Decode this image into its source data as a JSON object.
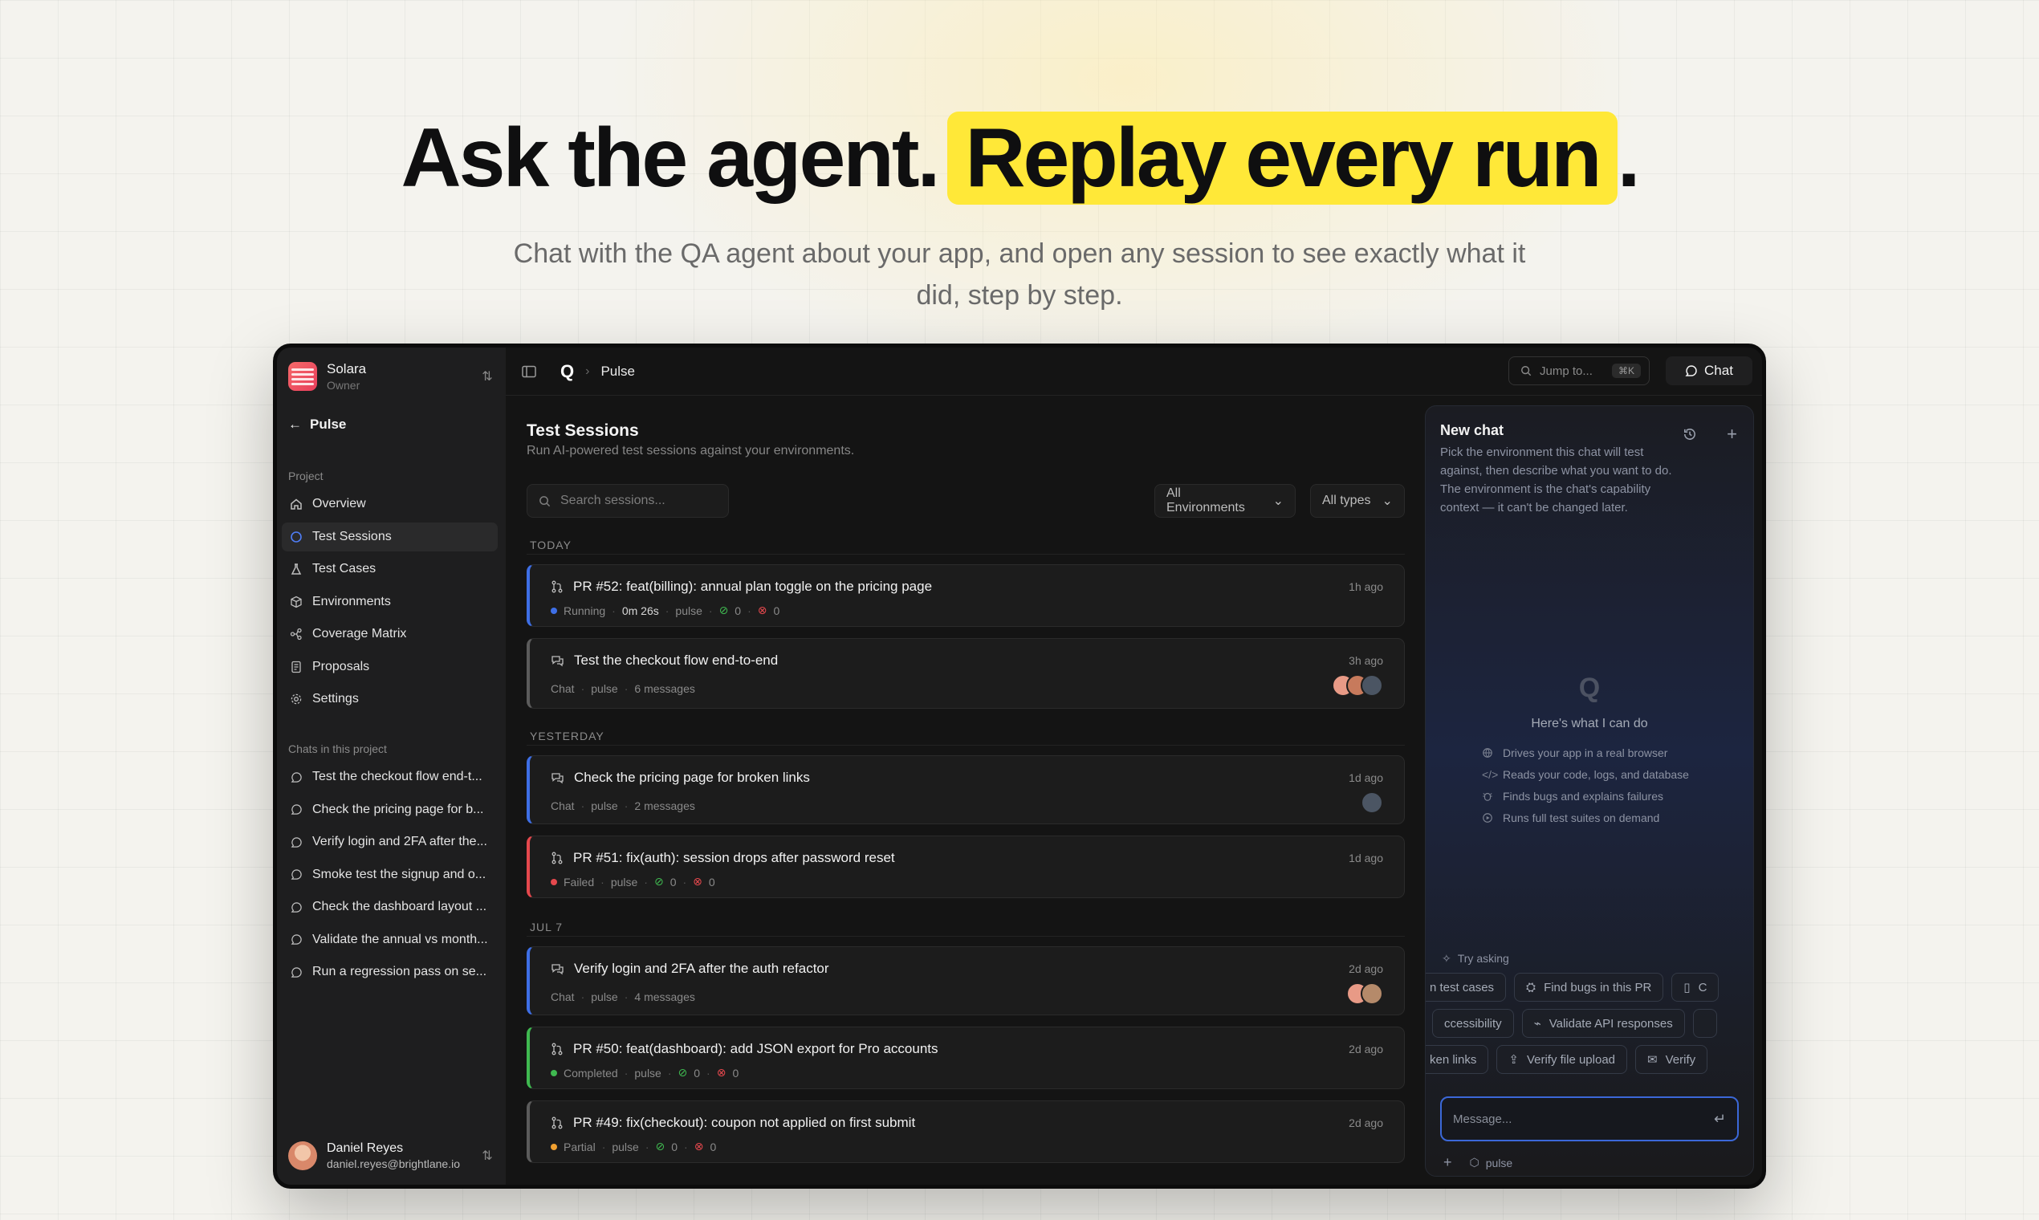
{
  "hero": {
    "title_part1": "Ask the agent.",
    "title_highlight": "Replay every run",
    "title_end": ".",
    "subtitle": "Chat with the QA agent about your app, and open any session to see exactly what it did, step by step."
  },
  "sidebar": {
    "org_name": "Solara",
    "org_role": "Owner",
    "back_label": "Pulse",
    "project_label": "Project",
    "nav": [
      {
        "label": "Overview",
        "icon": "home-icon"
      },
      {
        "label": "Test Sessions",
        "icon": "chat-bubble-icon",
        "active": true
      },
      {
        "label": "Test Cases",
        "icon": "flask-icon"
      },
      {
        "label": "Environments",
        "icon": "cube-icon"
      },
      {
        "label": "Coverage Matrix",
        "icon": "nodes-icon"
      },
      {
        "label": "Proposals",
        "icon": "document-icon"
      },
      {
        "label": "Settings",
        "icon": "gear-icon"
      }
    ],
    "chats_label": "Chats in this project",
    "chats": [
      "Test the checkout flow end-t...",
      "Check the pricing page for b...",
      "Verify login and 2FA after the...",
      "Smoke test the signup and o...",
      "Check the dashboard layout ...",
      "Validate the annual vs month...",
      "Run a regression pass on se..."
    ],
    "user_name": "Daniel Reyes",
    "user_email": "daniel.reyes@brightlane.io"
  },
  "topbar": {
    "logo": "Q",
    "breadcrumb": "Pulse",
    "jump_placeholder": "Jump to...",
    "jump_kbd": "⌘K",
    "chat_label": "Chat"
  },
  "sessions": {
    "title": "Test Sessions",
    "subtitle": "Run AI-powered test sessions against your environments.",
    "search_placeholder": "Search sessions...",
    "filter_env": "All Environments",
    "filter_type": "All types",
    "groups": [
      "TODAY",
      "YESTERDAY",
      "JUL 7"
    ],
    "items": [
      {
        "title": "PR #52: feat(billing): annual plan toggle on the pricing page",
        "time": "1h ago",
        "status": "Running",
        "duration": "0m 26s",
        "env": "pulse",
        "pass": "0",
        "fail": "0",
        "status_color": "#3e6fe6"
      },
      {
        "title": "Test the checkout flow end-to-end",
        "time": "3h ago",
        "kind": "Chat",
        "env": "pulse",
        "messages": "6 messages"
      },
      {
        "title": "Check the pricing page for broken links",
        "time": "1d ago",
        "kind": "Chat",
        "env": "pulse",
        "messages": "2 messages"
      },
      {
        "title": "PR #51: fix(auth): session drops after password reset",
        "time": "1d ago",
        "status": "Failed",
        "env": "pulse",
        "pass": "0",
        "fail": "0",
        "status_color": "#e5484d"
      },
      {
        "title": "Verify login and 2FA after the auth refactor",
        "time": "2d ago",
        "kind": "Chat",
        "env": "pulse",
        "messages": "4 messages"
      },
      {
        "title": "PR #50: feat(dashboard): add JSON export for Pro accounts",
        "time": "2d ago",
        "status": "Completed",
        "env": "pulse",
        "pass": "0",
        "fail": "0",
        "status_color": "#3fb950"
      },
      {
        "title": "PR #49: fix(checkout): coupon not applied on first submit",
        "time": "2d ago",
        "status": "Partial",
        "env": "pulse",
        "pass": "0",
        "fail": "0",
        "status_color": "#f0a030"
      }
    ]
  },
  "chat_panel": {
    "title": "New chat",
    "description": "Pick the environment this chat will test against, then describe what you want to do. The environment is the chat's capability context — it can't be changed later.",
    "logo": "Q",
    "can_do_title": "Here's what I can do",
    "capabilities": [
      "Drives your app in a real browser",
      "Reads your code, logs, and database",
      "Finds bugs and explains failures",
      "Runs full test suites on demand"
    ],
    "try_label": "Try asking",
    "chips_row1": [
      "n test cases",
      "Find bugs in this PR",
      "C"
    ],
    "chips_row2": [
      "ccessibility",
      "Validate API responses",
      ""
    ],
    "chips_row3": [
      "ken links",
      "Verify file upload",
      "Verify"
    ],
    "message_placeholder": "Message...",
    "env_label": "pulse"
  }
}
